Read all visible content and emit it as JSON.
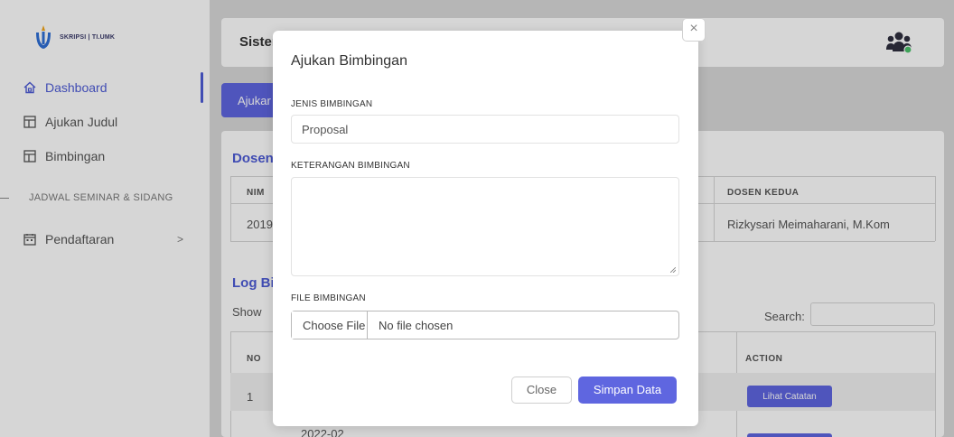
{
  "sidebar": {
    "logo_text": "SKRIPSI | TI.UMK",
    "items": [
      {
        "label": "Dashboard",
        "icon": "home-icon",
        "active": true
      },
      {
        "label": "Ajukan Judul",
        "icon": "table-icon",
        "active": false
      },
      {
        "label": "Bimbingan",
        "icon": "table-icon",
        "active": false
      }
    ],
    "section_heading": "JADWAL SEMINAR & SIDANG",
    "sub_items": [
      {
        "label": "Pendaftaran",
        "icon": "calendar-icon",
        "chevron": ">"
      }
    ]
  },
  "topbar": {
    "title": "Sister",
    "user_icon": "users-icon"
  },
  "page": {
    "tab_label": "Ajukar",
    "dosen_heading": "Dosen",
    "dosen_table": {
      "headers": {
        "nim": "NIM",
        "dosen_kedua": "DOSEN KEDUA"
      },
      "row": {
        "nim": "2019",
        "dosen_kedua": "Rizkysari Meimaharani, M.Kom"
      }
    },
    "log_heading": "Log Bi",
    "show_label": "Show",
    "search_label": "Search:",
    "log_table": {
      "headers": {
        "no": "NO",
        "action": "ACTION"
      },
      "rows": [
        {
          "no": "1",
          "action_label": "Lihat Catatan"
        },
        {
          "date": "2022-02"
        }
      ]
    }
  },
  "modal": {
    "title": "Ajukan Bimbingan",
    "close_icon": "close-icon",
    "close_glyph": "×",
    "fields": {
      "jenis_label": "JENIS BIMBINGAN",
      "jenis_value": "Proposal",
      "keterangan_label": "KETERANGAN BIMBINGAN",
      "keterangan_value": "",
      "file_label": "FILE BIMBINGAN",
      "choose_file_label": "Choose File",
      "no_file_text": "No file chosen"
    },
    "buttons": {
      "close_label": "Close",
      "save_label": "Simpan Data"
    }
  },
  "colors": {
    "accent": "#5f66e0",
    "accent_text": "#4d5bd6",
    "overlay": "rgba(0,0,0,0.16)"
  }
}
